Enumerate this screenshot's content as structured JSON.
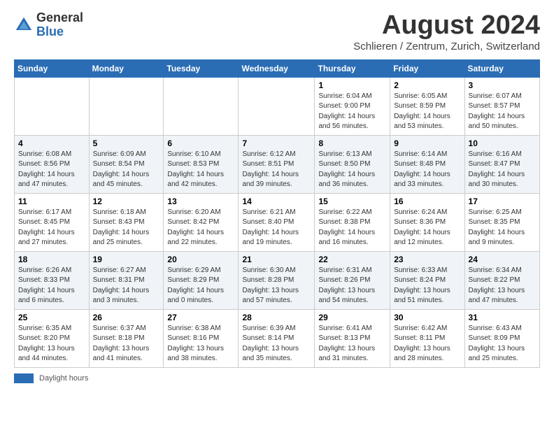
{
  "header": {
    "logo_general": "General",
    "logo_blue": "Blue",
    "month_year": "August 2024",
    "location": "Schlieren / Zentrum, Zurich, Switzerland"
  },
  "days_of_week": [
    "Sunday",
    "Monday",
    "Tuesday",
    "Wednesday",
    "Thursday",
    "Friday",
    "Saturday"
  ],
  "weeks": [
    [
      {
        "day": "",
        "info": ""
      },
      {
        "day": "",
        "info": ""
      },
      {
        "day": "",
        "info": ""
      },
      {
        "day": "",
        "info": ""
      },
      {
        "day": "1",
        "info": "Sunrise: 6:04 AM\nSunset: 9:00 PM\nDaylight: 14 hours\nand 56 minutes."
      },
      {
        "day": "2",
        "info": "Sunrise: 6:05 AM\nSunset: 8:59 PM\nDaylight: 14 hours\nand 53 minutes."
      },
      {
        "day": "3",
        "info": "Sunrise: 6:07 AM\nSunset: 8:57 PM\nDaylight: 14 hours\nand 50 minutes."
      }
    ],
    [
      {
        "day": "4",
        "info": "Sunrise: 6:08 AM\nSunset: 8:56 PM\nDaylight: 14 hours\nand 47 minutes."
      },
      {
        "day": "5",
        "info": "Sunrise: 6:09 AM\nSunset: 8:54 PM\nDaylight: 14 hours\nand 45 minutes."
      },
      {
        "day": "6",
        "info": "Sunrise: 6:10 AM\nSunset: 8:53 PM\nDaylight: 14 hours\nand 42 minutes."
      },
      {
        "day": "7",
        "info": "Sunrise: 6:12 AM\nSunset: 8:51 PM\nDaylight: 14 hours\nand 39 minutes."
      },
      {
        "day": "8",
        "info": "Sunrise: 6:13 AM\nSunset: 8:50 PM\nDaylight: 14 hours\nand 36 minutes."
      },
      {
        "day": "9",
        "info": "Sunrise: 6:14 AM\nSunset: 8:48 PM\nDaylight: 14 hours\nand 33 minutes."
      },
      {
        "day": "10",
        "info": "Sunrise: 6:16 AM\nSunset: 8:47 PM\nDaylight: 14 hours\nand 30 minutes."
      }
    ],
    [
      {
        "day": "11",
        "info": "Sunrise: 6:17 AM\nSunset: 8:45 PM\nDaylight: 14 hours\nand 27 minutes."
      },
      {
        "day": "12",
        "info": "Sunrise: 6:18 AM\nSunset: 8:43 PM\nDaylight: 14 hours\nand 25 minutes."
      },
      {
        "day": "13",
        "info": "Sunrise: 6:20 AM\nSunset: 8:42 PM\nDaylight: 14 hours\nand 22 minutes."
      },
      {
        "day": "14",
        "info": "Sunrise: 6:21 AM\nSunset: 8:40 PM\nDaylight: 14 hours\nand 19 minutes."
      },
      {
        "day": "15",
        "info": "Sunrise: 6:22 AM\nSunset: 8:38 PM\nDaylight: 14 hours\nand 16 minutes."
      },
      {
        "day": "16",
        "info": "Sunrise: 6:24 AM\nSunset: 8:36 PM\nDaylight: 14 hours\nand 12 minutes."
      },
      {
        "day": "17",
        "info": "Sunrise: 6:25 AM\nSunset: 8:35 PM\nDaylight: 14 hours\nand 9 minutes."
      }
    ],
    [
      {
        "day": "18",
        "info": "Sunrise: 6:26 AM\nSunset: 8:33 PM\nDaylight: 14 hours\nand 6 minutes."
      },
      {
        "day": "19",
        "info": "Sunrise: 6:27 AM\nSunset: 8:31 PM\nDaylight: 14 hours\nand 3 minutes."
      },
      {
        "day": "20",
        "info": "Sunrise: 6:29 AM\nSunset: 8:29 PM\nDaylight: 14 hours\nand 0 minutes."
      },
      {
        "day": "21",
        "info": "Sunrise: 6:30 AM\nSunset: 8:28 PM\nDaylight: 13 hours\nand 57 minutes."
      },
      {
        "day": "22",
        "info": "Sunrise: 6:31 AM\nSunset: 8:26 PM\nDaylight: 13 hours\nand 54 minutes."
      },
      {
        "day": "23",
        "info": "Sunrise: 6:33 AM\nSunset: 8:24 PM\nDaylight: 13 hours\nand 51 minutes."
      },
      {
        "day": "24",
        "info": "Sunrise: 6:34 AM\nSunset: 8:22 PM\nDaylight: 13 hours\nand 47 minutes."
      }
    ],
    [
      {
        "day": "25",
        "info": "Sunrise: 6:35 AM\nSunset: 8:20 PM\nDaylight: 13 hours\nand 44 minutes."
      },
      {
        "day": "26",
        "info": "Sunrise: 6:37 AM\nSunset: 8:18 PM\nDaylight: 13 hours\nand 41 minutes."
      },
      {
        "day": "27",
        "info": "Sunrise: 6:38 AM\nSunset: 8:16 PM\nDaylight: 13 hours\nand 38 minutes."
      },
      {
        "day": "28",
        "info": "Sunrise: 6:39 AM\nSunset: 8:14 PM\nDaylight: 13 hours\nand 35 minutes."
      },
      {
        "day": "29",
        "info": "Sunrise: 6:41 AM\nSunset: 8:13 PM\nDaylight: 13 hours\nand 31 minutes."
      },
      {
        "day": "30",
        "info": "Sunrise: 6:42 AM\nSunset: 8:11 PM\nDaylight: 13 hours\nand 28 minutes."
      },
      {
        "day": "31",
        "info": "Sunrise: 6:43 AM\nSunset: 8:09 PM\nDaylight: 13 hours\nand 25 minutes."
      }
    ]
  ],
  "legend": {
    "label": "Daylight hours"
  }
}
